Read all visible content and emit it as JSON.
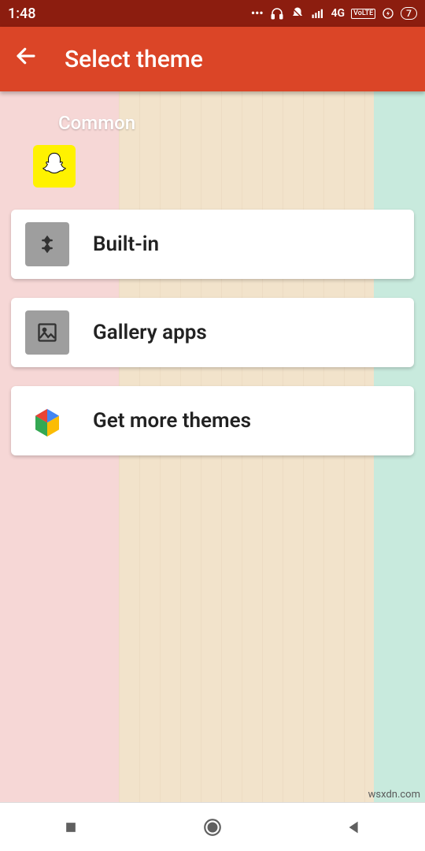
{
  "statusbar": {
    "time": "1:48",
    "network_label": "4G",
    "volte_label": "VoLTE",
    "battery_label": "7"
  },
  "appbar": {
    "title": "Select theme"
  },
  "section": {
    "label": "Common"
  },
  "tiles": {
    "snapchat_name": "snapchat"
  },
  "cards": {
    "built_in": "Built-in",
    "gallery_apps": "Gallery apps",
    "get_more_themes": "Get more themes"
  },
  "watermark": "wsxdn.com"
}
